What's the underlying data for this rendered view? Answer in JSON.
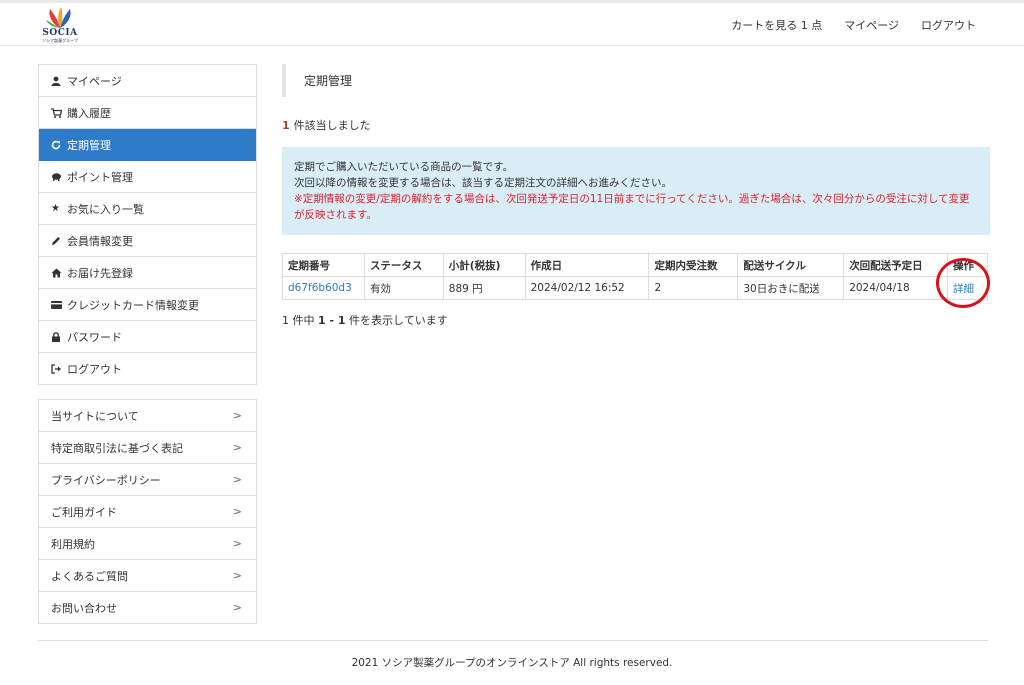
{
  "header": {
    "logo_text": "SOCIA",
    "logo_subtext": "ソシア製薬グループ",
    "nav": [
      "カートを見る 1 点",
      "マイページ",
      "ログアウト"
    ]
  },
  "sidebar": {
    "items": [
      {
        "label": "マイページ",
        "icon": "person-icon"
      },
      {
        "label": "購入履歴",
        "icon": "cart-icon"
      },
      {
        "label": "定期管理",
        "icon": "refresh-icon"
      },
      {
        "label": "ポイント管理",
        "icon": "piggy-bank-icon"
      },
      {
        "label": "お気に入り一覧",
        "icon": "star-icon"
      },
      {
        "label": "会員情報変更",
        "icon": "pencil-icon"
      },
      {
        "label": "お届け先登録",
        "icon": "home-icon"
      },
      {
        "label": "クレジットカード情報変更",
        "icon": "credit-card-icon"
      },
      {
        "label": "パスワード",
        "icon": "lock-icon"
      },
      {
        "label": "ログアウト",
        "icon": "logout-icon"
      }
    ],
    "active_index": 2,
    "links": [
      {
        "label": "当サイトについて",
        "arrow": ">"
      },
      {
        "label": "特定商取引法に基づく表記",
        "arrow": ">"
      },
      {
        "label": "プライバシーポリシー",
        "arrow": ">"
      },
      {
        "label": "ご利用ガイド",
        "arrow": ">"
      },
      {
        "label": "利用規約",
        "arrow": ">"
      },
      {
        "label": "よくあるご質問",
        "arrow": ">"
      },
      {
        "label": "お問い合わせ",
        "arrow": ">"
      }
    ]
  },
  "main": {
    "title": "定期管理",
    "result_num": "1",
    "result_text": "件該当しました",
    "info": {
      "line1": "定期でご購入いただいている商品の一覧です。",
      "line2": "次回以降の情報を変更する場合は、該当する定期注文の詳細へお進みください。",
      "warning": "※定期情報の変更/定期の解約をする場合は、次回発送予定日の11日前までに行ってください。過ぎた場合は、次々回分からの受注に対して変更が反映されます。"
    },
    "table": {
      "headers": [
        "定期番号",
        "ステータス",
        "小計(税抜)",
        "作成日",
        "定期内受注数",
        "配送サイクル",
        "次回配送予定日",
        "操作"
      ],
      "rows": [
        [
          "d67f6b60d3",
          "有効",
          "889 円",
          "2024/02/12 16:52",
          "2",
          "30日おきに配送",
          "2024/04/18",
          "詳細"
        ]
      ]
    },
    "pager": {
      "total": "1",
      "mid1": " 件中 ",
      "from": "1",
      "dash": " - ",
      "to": "1",
      "tail": " 件を表示しています"
    }
  },
  "footer": {
    "text": "2021 ソシア製薬グループのオンラインストア All rights reserved."
  },
  "colors": {
    "accent": "#2e7bc9",
    "warning": "#e0202a",
    "info_bg": "#d9edf7",
    "annotation_circle": "#d9131b"
  }
}
